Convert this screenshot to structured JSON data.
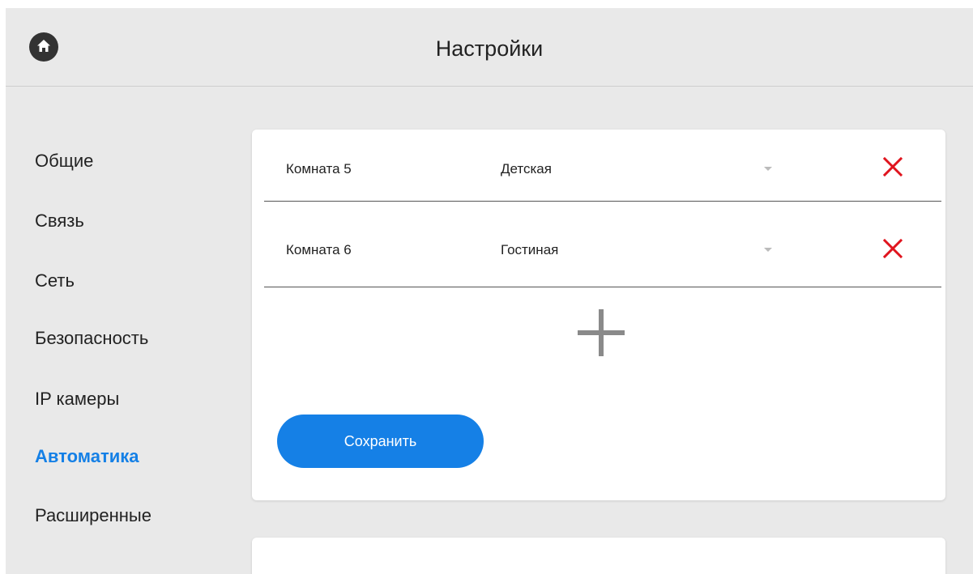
{
  "header": {
    "title": "Настройки",
    "home_icon": "home-icon"
  },
  "sidebar": {
    "items": [
      {
        "label": "Общие",
        "active": false
      },
      {
        "label": "Связь",
        "active": false
      },
      {
        "label": "Сеть",
        "active": false
      },
      {
        "label": "Безопасность",
        "active": false
      },
      {
        "label": "IP камеры",
        "active": false
      },
      {
        "label": "Автоматика",
        "active": true
      },
      {
        "label": "Расширенные",
        "active": false
      }
    ]
  },
  "rooms": [
    {
      "name": "Комната 5",
      "type": "Детская"
    },
    {
      "name": "Комната 6",
      "type": "Гостиная"
    }
  ],
  "actions": {
    "add_icon": "plus-icon",
    "save_label": "Сохранить"
  },
  "colors": {
    "accent": "#1580e6",
    "delete": "#e0141e",
    "background": "#e9e9e9"
  }
}
